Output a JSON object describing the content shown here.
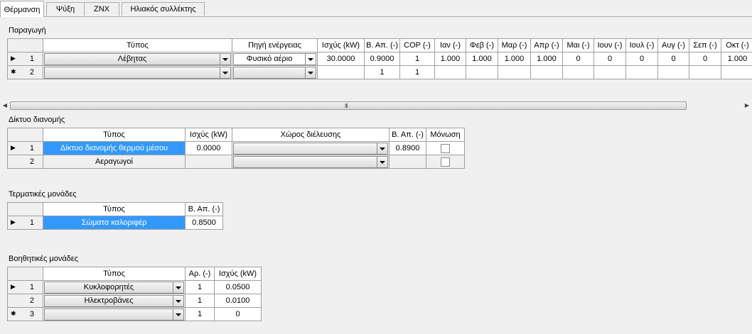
{
  "tabs": [
    {
      "label": "Θέρμανση",
      "active": true
    },
    {
      "label": "Ψύξη",
      "active": false
    },
    {
      "label": "ZNX",
      "active": false
    },
    {
      "label": "Ηλιακός συλλέκτης",
      "active": false
    }
  ],
  "production": {
    "title": "Παραγωγή",
    "headers": [
      "Τύπος",
      "Πηγή ενέργειας",
      "Ισχύς (kW)",
      "Β. Απ. (-)",
      "COP (-)",
      "Ιαν (-)",
      "Φεβ (-)",
      "Μαρ (-)",
      "Απρ (-)",
      "Μαι (-)",
      "Ιουν (-)",
      "Ιουλ (-)",
      "Αυγ (-)",
      "Σεπ (-)",
      "Οκτ (-)"
    ],
    "rows": [
      {
        "marker": "▶",
        "num": "1",
        "type": "Λέβητας",
        "source": "Φυσικό αέριο",
        "power": "30.0000",
        "eff": "0.9000",
        "cop": "1",
        "months": [
          "1.000",
          "1.000",
          "1.000",
          "1.000",
          "0",
          "0",
          "0",
          "0",
          "0",
          "1.000"
        ]
      },
      {
        "marker": "✱",
        "num": "2",
        "type": "",
        "source": "",
        "power": "",
        "eff": "1",
        "cop": "1",
        "months": [
          "",
          "",
          "",
          "",
          "",
          "",
          "",
          "",
          "",
          ""
        ]
      }
    ]
  },
  "scrollbar": {
    "grip": "III"
  },
  "distribution": {
    "title": "Δίκτυο διανομής",
    "headers": [
      "Τύπος",
      "Ισχύς (kW)",
      "Χώρος διέλευσης",
      "Β. Απ. (-)",
      "Μόνωση"
    ],
    "rows": [
      {
        "marker": "▶",
        "num": "1",
        "type": "Δίκτυο διανομής θερμού μέσου",
        "power": "0.0000",
        "space": "",
        "eff": "0.8900",
        "insulation": false
      },
      {
        "marker": "",
        "num": "2",
        "type": "Αεραγωγοί",
        "power": "",
        "space": "",
        "eff": "",
        "insulation": false
      }
    ]
  },
  "terminal": {
    "title": "Τερματικές μονάδες",
    "headers": [
      "Τύπος",
      "Β. Απ. (-)"
    ],
    "rows": [
      {
        "marker": "▶",
        "num": "1",
        "type": "Σώματα καλοριφέρ",
        "eff": "0.8500"
      }
    ]
  },
  "auxiliary": {
    "title": "Βοηθητικές μονάδες",
    "headers": [
      "Τύπος",
      "Αρ. (-)",
      "Ισχύς (kW)"
    ],
    "rows": [
      {
        "marker": "▶",
        "num": "1",
        "type": "Κυκλοφορητές",
        "count": "1",
        "power": "0.0500"
      },
      {
        "marker": "",
        "num": "2",
        "type": "Ηλεκτροβάνες",
        "count": "1",
        "power": "0.0100"
      },
      {
        "marker": "✱",
        "num": "3",
        "type": "",
        "count": "1",
        "power": "0"
      }
    ]
  },
  "colors": {
    "selection": "#3399ff",
    "background": "#f0f0f0",
    "grid_border": "#a0a0a0"
  }
}
